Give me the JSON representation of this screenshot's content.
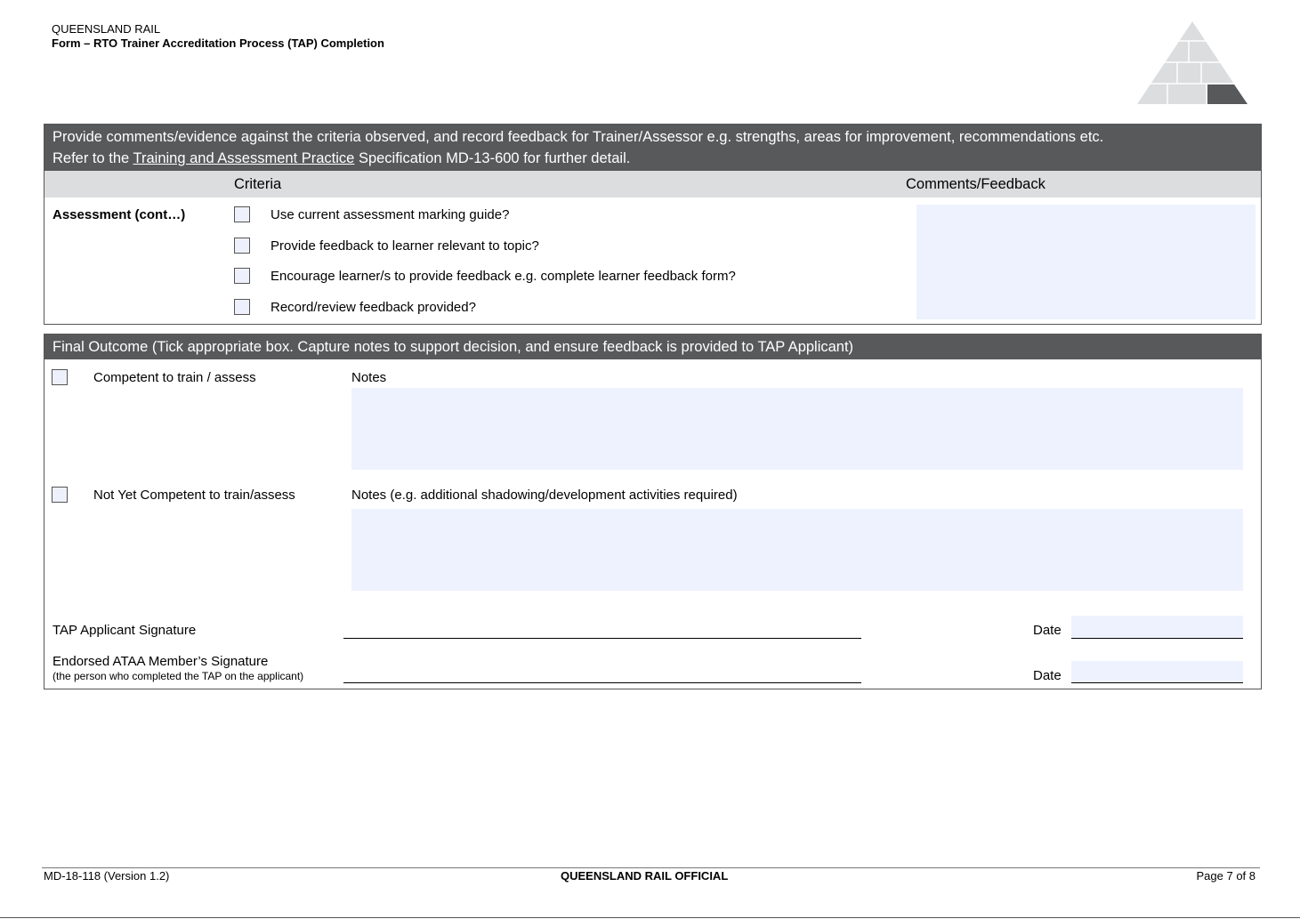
{
  "header": {
    "org": "QUEENSLAND RAIL",
    "form_title": "Form – RTO Trainer Accreditation Process (TAP) Completion"
  },
  "section1": {
    "instruction_line1": "Provide comments/evidence against the criteria observed, and record feedback for Trainer/Assessor e.g. strengths, areas for improvement, recommendations etc.",
    "instruction_prefix": "Refer to the ",
    "link_text": "Training and Assessment Practice",
    "instruction_suffix": " Specification MD-13-600 for further detail.",
    "col_criteria": "Criteria",
    "col_comments": "Comments/Feedback",
    "row_label": "Assessment (cont…)",
    "criteria": [
      {
        "label": "Use current assessment marking guide?",
        "checked": false
      },
      {
        "label": "Provide feedback to learner relevant to topic?",
        "checked": false
      },
      {
        "label": "Encourage learner/s to provide feedback e.g. complete learner feedback form?",
        "checked": false
      },
      {
        "label": "Record/review feedback provided?",
        "checked": false
      }
    ]
  },
  "section2": {
    "title": "Final Outcome (Tick appropriate box. Capture notes to support decision, and ensure feedback is provided to TAP Applicant)",
    "competent_label": "Competent to train / assess",
    "competent_notes_label": "Notes",
    "nyc_label": "Not Yet Competent to train/assess",
    "nyc_notes_label": "Notes (e.g. additional shadowing/development activities required)",
    "applicant_sig_label": "TAP Applicant Signature",
    "endorsed_sig_label": "Endorsed ATAA Member’s Signature",
    "endorsed_sig_sub": "(the person who completed the TAP on the applicant)",
    "date_label": "Date"
  },
  "footer": {
    "doc_id": "MD-18-118 (Version 1.2)",
    "classification": "QUEENSLAND RAIL OFFICIAL",
    "page": "Page 7 of 8"
  }
}
